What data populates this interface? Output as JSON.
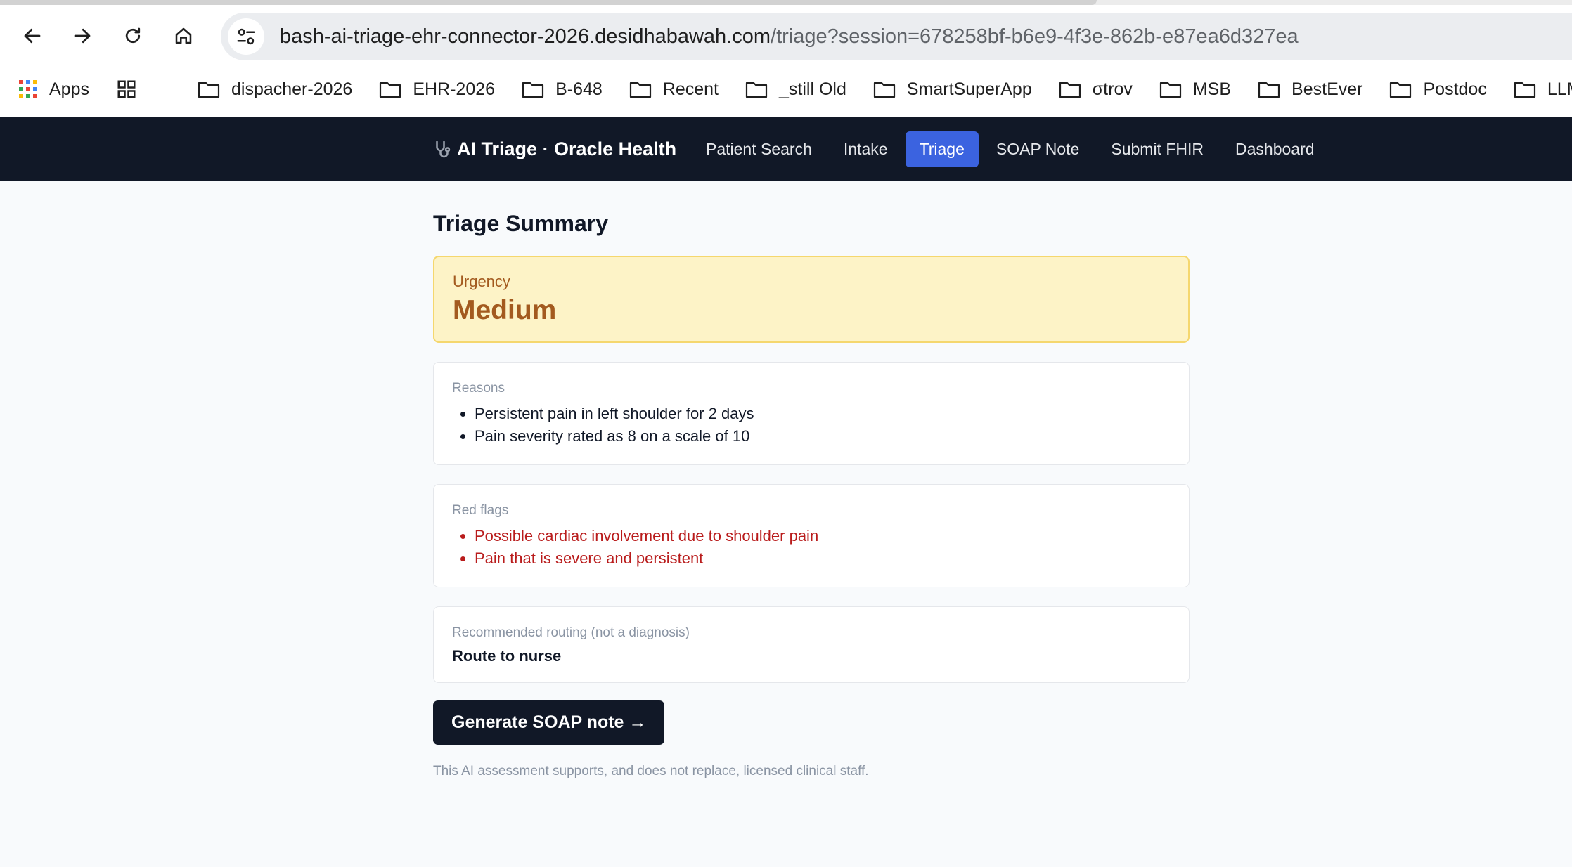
{
  "browser": {
    "url_host": "bash-ai-triage-ehr-connector-2026.desidhabawah.com",
    "url_path": "/triage?session=678258bf-b6e9-4f3e-862b-e87ea6d327ea",
    "bookmarks": {
      "apps": "Apps",
      "folders": [
        "dispacher-2026",
        "EHR-2026",
        "B-648",
        "Recent",
        "_still Old",
        "SmartSuperApp",
        "σtrov",
        "MSB",
        "BestEver",
        "Postdoc",
        "LLM"
      ]
    }
  },
  "app": {
    "brand": "AI Triage · Oracle Health",
    "nav": {
      "patient_search": "Patient Search",
      "intake": "Intake",
      "triage": "Triage",
      "soap_note": "SOAP Note",
      "submit_fhir": "Submit FHIR",
      "dashboard": "Dashboard"
    },
    "accent": "#3b63e0"
  },
  "triage": {
    "title": "Triage Summary",
    "urgency_label": "Urgency",
    "urgency_value": "Medium",
    "reasons_label": "Reasons",
    "reasons": [
      "Persistent pain in left shoulder for 2 days",
      "Pain severity rated as 8 on a scale of 10"
    ],
    "red_flags_label": "Red flags",
    "red_flags": [
      "Possible cardiac involvement due to shoulder pain",
      "Pain that is severe and persistent"
    ],
    "routing_label": "Recommended routing (not a diagnosis)",
    "routing_value": "Route to nurse",
    "cta_label": "Generate SOAP note →",
    "disclaimer": "This AI assessment supports, and does not replace, licensed clinical staff."
  }
}
